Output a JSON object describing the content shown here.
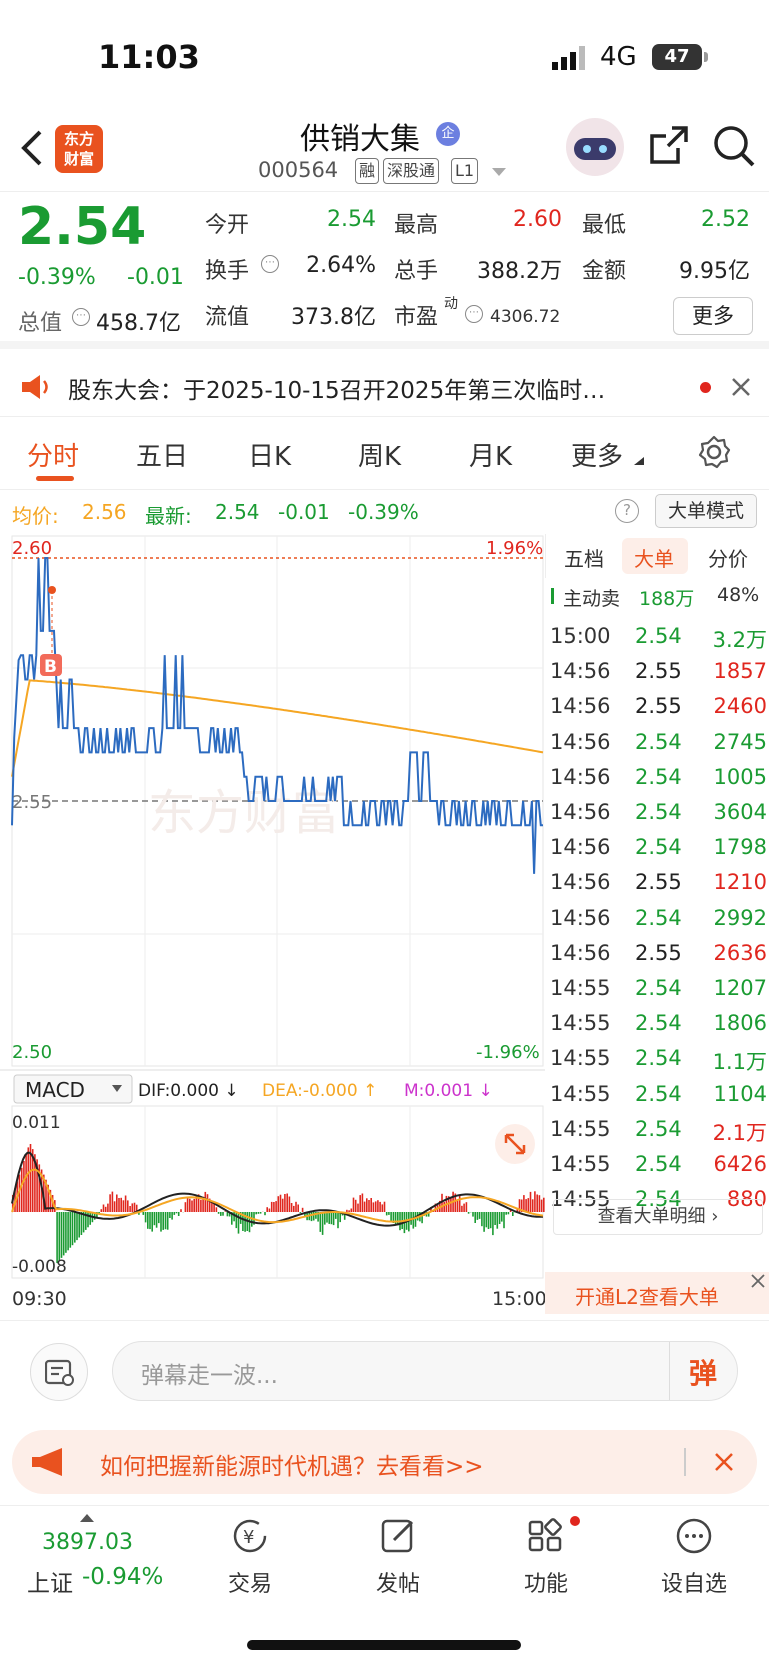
{
  "status": {
    "time": "11:03",
    "network": "4G",
    "battery": "47"
  },
  "header": {
    "logo_line1": "东方",
    "logo_line2": "财富",
    "title": "供销大集",
    "title_badge": "企",
    "code": "000564",
    "tags": [
      "融",
      "深股通",
      "L1"
    ]
  },
  "quote": {
    "price": "2.54",
    "change_pct": "-0.39%",
    "change": "-0.01",
    "open_label": "今开",
    "open": "2.54",
    "high_label": "最高",
    "high": "2.60",
    "low_label": "最低",
    "low": "2.52",
    "turnover_label": "换手",
    "turnover": "2.64%",
    "volume_label": "总手",
    "volume": "388.2万",
    "amount_label": "金额",
    "amount": "9.95亿",
    "mktcap_label": "总值",
    "mktcap": "458.7亿",
    "float_label": "流值",
    "float": "373.8亿",
    "pe_label": "市盈",
    "pe_sup": "动",
    "pe": "4306.72",
    "more": "更多"
  },
  "notice": {
    "text": "股东大会：于2025-10-15召开2025年第三次临时…"
  },
  "tabs": [
    "分时",
    "五日",
    "日K",
    "周K",
    "月K",
    "更多"
  ],
  "infobar": {
    "avg_label": "均价:",
    "avg": "2.56",
    "latest_label": "最新:",
    "latest": "2.54",
    "latest_change": "-0.01",
    "latest_pct": "-0.39%",
    "mode_button": "大单模式"
  },
  "chart_labels": {
    "top_price": "2.60",
    "top_pct": "1.96%",
    "mid_price": "2.55",
    "bottom_price": "2.50",
    "bottom_pct": "-1.96%",
    "macd_select": "MACD",
    "dif": "DIF:0.000 ↓",
    "dea": "DEA:-0.000 ↑",
    "m": "M:0.001 ↓",
    "macd_top": "0.011",
    "macd_bottom": "-0.008",
    "time_start": "09:30",
    "time_end": "15:00",
    "watermark": "东方财富",
    "buy_marker": "B"
  },
  "colors": {
    "up": "#e0261e",
    "down": "#1a9b32",
    "accent": "#e9521f",
    "price_line": "#2c6bc0",
    "avg_line": "#f5a623"
  },
  "right_panel": {
    "tabs": [
      "五档",
      "大单",
      "分价"
    ],
    "summary_label": "主动卖",
    "summary_vol": "188万",
    "summary_pct": "48%",
    "trades": [
      {
        "time": "15:00",
        "price": "2.54",
        "vol": "3.2万",
        "pc": "green",
        "vc": "green"
      },
      {
        "time": "14:56",
        "price": "2.55",
        "vol": "1857",
        "pc": "black",
        "vc": "red"
      },
      {
        "time": "14:56",
        "price": "2.55",
        "vol": "2460",
        "pc": "black",
        "vc": "red"
      },
      {
        "time": "14:56",
        "price": "2.54",
        "vol": "2745",
        "pc": "green",
        "vc": "green"
      },
      {
        "time": "14:56",
        "price": "2.54",
        "vol": "1005",
        "pc": "green",
        "vc": "green"
      },
      {
        "time": "14:56",
        "price": "2.54",
        "vol": "3604",
        "pc": "green",
        "vc": "green"
      },
      {
        "time": "14:56",
        "price": "2.54",
        "vol": "1798",
        "pc": "green",
        "vc": "green"
      },
      {
        "time": "14:56",
        "price": "2.55",
        "vol": "1210",
        "pc": "black",
        "vc": "red"
      },
      {
        "time": "14:56",
        "price": "2.54",
        "vol": "2992",
        "pc": "green",
        "vc": "green"
      },
      {
        "time": "14:56",
        "price": "2.55",
        "vol": "2636",
        "pc": "black",
        "vc": "red"
      },
      {
        "time": "14:55",
        "price": "2.54",
        "vol": "1207",
        "pc": "green",
        "vc": "green"
      },
      {
        "time": "14:55",
        "price": "2.54",
        "vol": "1806",
        "pc": "green",
        "vc": "green"
      },
      {
        "time": "14:55",
        "price": "2.54",
        "vol": "1.1万",
        "pc": "green",
        "vc": "green"
      },
      {
        "time": "14:55",
        "price": "2.54",
        "vol": "1104",
        "pc": "green",
        "vc": "green"
      },
      {
        "time": "14:55",
        "price": "2.54",
        "vol": "2.1万",
        "pc": "green",
        "vc": "red"
      },
      {
        "time": "14:55",
        "price": "2.54",
        "vol": "6426",
        "pc": "green",
        "vc": "red"
      },
      {
        "time": "14:55",
        "price": "2.54",
        "vol": "880",
        "pc": "green",
        "vc": "red"
      }
    ],
    "detail_link": "查看大单明细",
    "l2_promo": "开通L2查看大单"
  },
  "input": {
    "placeholder": "弹幕走一波...",
    "danmu_btn": "弹"
  },
  "ad": {
    "text": "如何把握新能源时代机遇？去看看>>"
  },
  "bottom_nav": {
    "index_value": "3897.03",
    "index_name": "上证",
    "index_pct": "-0.94%",
    "items": [
      "交易",
      "发帖",
      "功能",
      "设自选"
    ]
  }
}
